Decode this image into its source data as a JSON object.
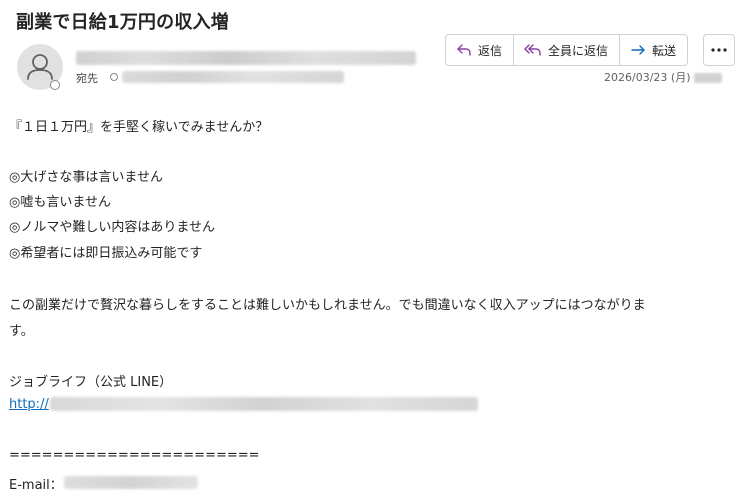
{
  "email": {
    "subject": "副業で日給1万円の収入増",
    "to_label": "宛先",
    "date": "2026/03/23 (月)"
  },
  "actions": {
    "reply": "返信",
    "reply_all": "全員に返信",
    "forward": "転送"
  },
  "icons": {
    "reply": "reply-arrow-icon",
    "reply_all": "reply-all-arrow-icon",
    "forward": "forward-arrow-icon",
    "more": "more-horizontal-icon",
    "avatar": "person-icon"
  },
  "colors": {
    "reply_icon": "#8a3ea3",
    "forward_icon": "#0f6cbd",
    "link": "#0f6cbd"
  },
  "body": {
    "line1": "『１日１万円』を手堅く稼いでみませんか？",
    "bullet1": "◎大げさな事は言いません",
    "bullet2": "◎嘘も言いません",
    "bullet3": "◎ノルマや難しい内容はありません",
    "bullet4": "◎希望者には即日振込み可能です",
    "para1_a": "この副業だけで贅沢な暮らしをすることは難しいかもしれません。でも間違いなく収入アップにはつながりま",
    "para1_b": "す。",
    "contact_name": "ジョブライフ（公式 LINE）",
    "link_prefix": "http://",
    "separator": "=======================",
    "email_label": "E-mail："
  }
}
